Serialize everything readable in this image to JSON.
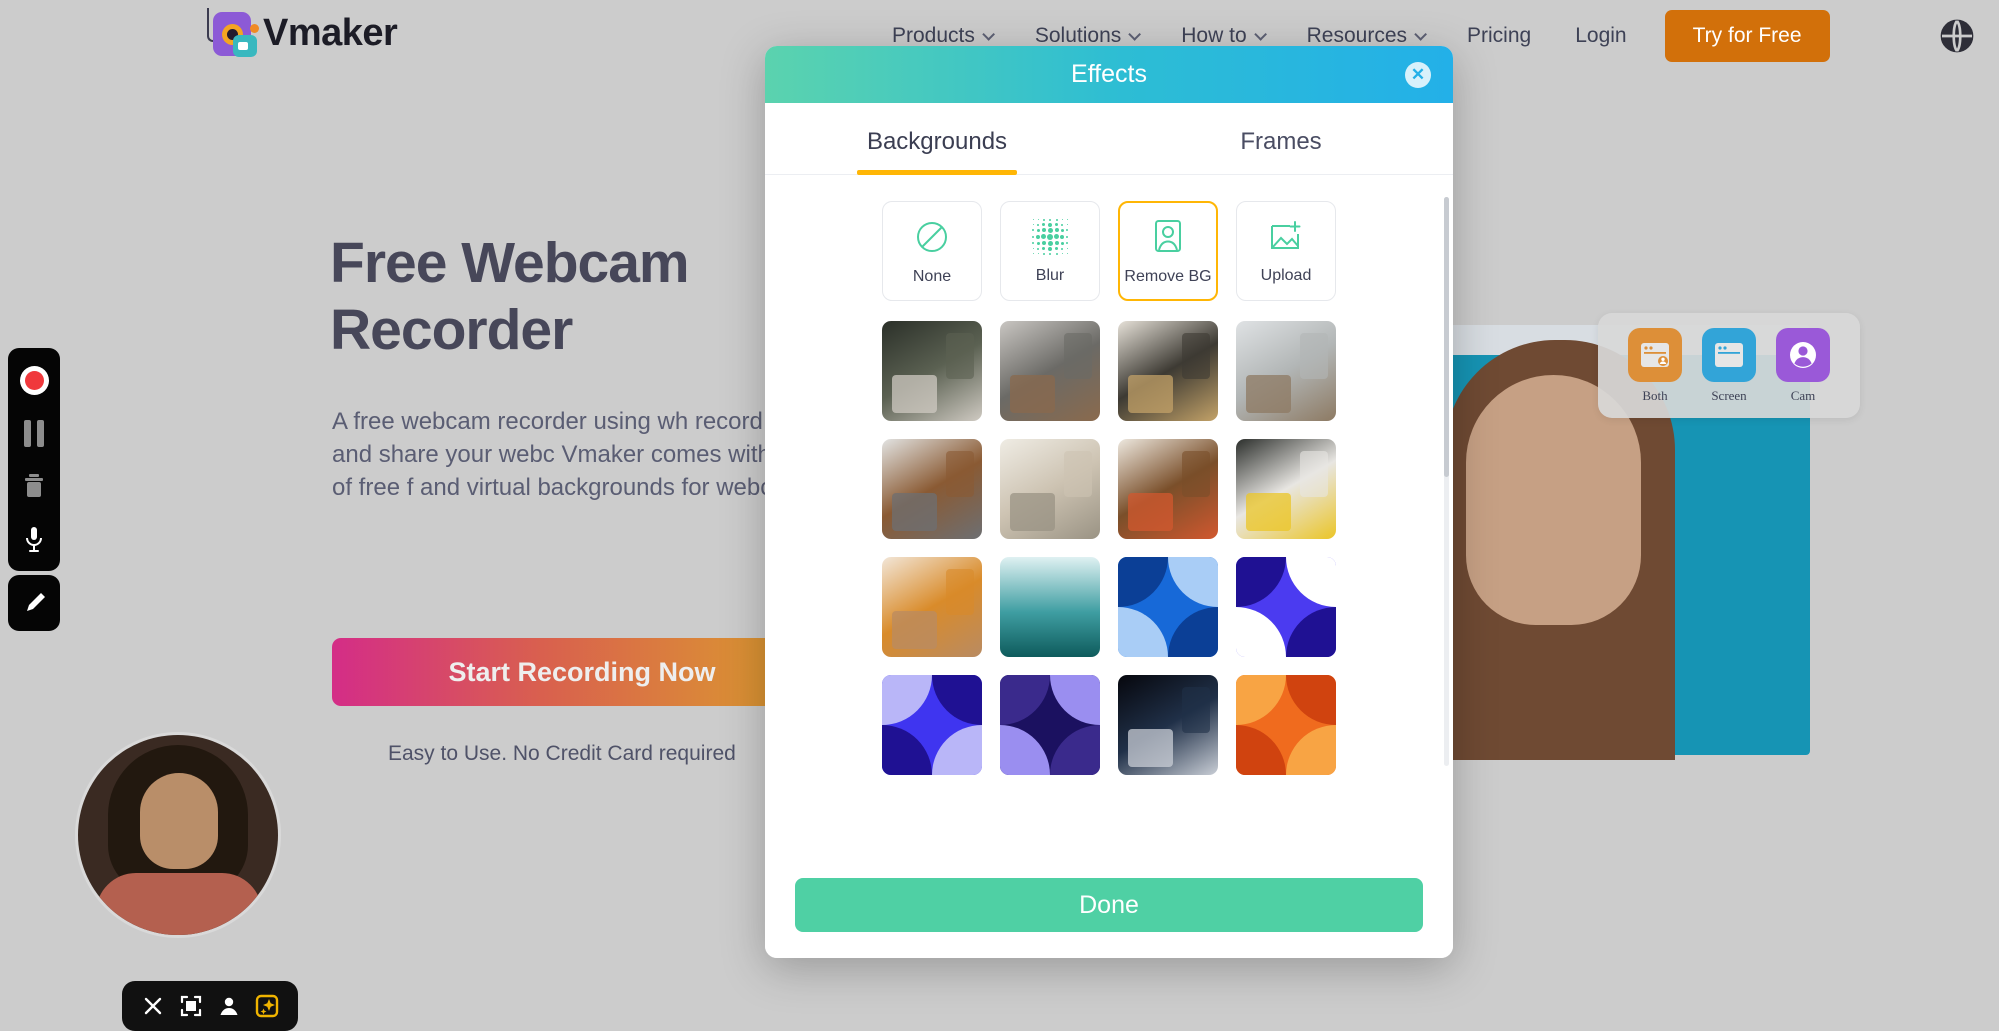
{
  "site": {
    "brand": "Vmaker",
    "nav_items": [
      {
        "label": "Products",
        "has_caret": true
      },
      {
        "label": "Solutions",
        "has_caret": true
      },
      {
        "label": "How to",
        "has_caret": true
      },
      {
        "label": "Resources",
        "has_caret": true
      },
      {
        "label": "Pricing",
        "has_caret": false
      },
      {
        "label": "Login",
        "has_caret": false
      }
    ],
    "cta_label": "Try for Free",
    "cta_color": "#d2700a",
    "globe_icon": "globe-icon",
    "hero_title_line1": "Free Webcam",
    "hero_title_line2": "Recorder",
    "hero_paragraph": "A free webcam recorder using wh record, edit, and share your webc Vmaker comes with a set of free f and virtual backgrounds for webc",
    "hero_button": "Start Recording Now",
    "hero_note": "Easy to Use. No Credit Card required"
  },
  "mode_panel": {
    "items": [
      {
        "label": "Both",
        "icon": "both-window-cam-icon",
        "color": "#dd8f38"
      },
      {
        "label": "Screen",
        "icon": "screen-window-icon",
        "color": "#32a4d8"
      },
      {
        "label": "Cam",
        "icon": "cam-person-icon",
        "color": "#9a59d8"
      }
    ]
  },
  "recorder_toolbar": {
    "buttons": [
      {
        "name": "record-button",
        "icon": "record-dot-icon"
      },
      {
        "name": "pause-button",
        "icon": "pause-icon"
      },
      {
        "name": "delete-button",
        "icon": "trash-icon"
      },
      {
        "name": "mic-button",
        "icon": "microphone-icon"
      }
    ],
    "pen_button": {
      "name": "pen-button",
      "icon": "pen-icon"
    }
  },
  "cam_toolbar": {
    "buttons": [
      {
        "name": "close-cam-button",
        "icon": "close-x-icon"
      },
      {
        "name": "resize-cam-button",
        "icon": "expand-frame-icon"
      },
      {
        "name": "avatar-cam-button",
        "icon": "person-icon"
      },
      {
        "name": "effects-cam-button",
        "icon": "sparkle-effects-icon",
        "active": true
      }
    ]
  },
  "modal": {
    "title": "Effects",
    "close_icon": "close-circle-icon",
    "header_gradient": [
      "#5bd3ae",
      "#23b0e8"
    ],
    "accent_color": "#ffb605",
    "tabs": [
      {
        "label": "Backgrounds",
        "active": true
      },
      {
        "label": "Frames",
        "active": false
      }
    ],
    "options": [
      {
        "label": "None",
        "icon": "no-background-icon",
        "selected": false
      },
      {
        "label": "Blur",
        "icon": "blur-dots-icon",
        "selected": false
      },
      {
        "label": "Remove BG",
        "icon": "remove-background-person-icon",
        "selected": true
      },
      {
        "label": "Upload",
        "icon": "upload-image-icon",
        "selected": false
      }
    ],
    "thumbnails": [
      {
        "name": "dark-green-armchair-room",
        "kind": "photo",
        "palette": [
          "#2b3029",
          "#5b6152",
          "#cfcac2"
        ]
      },
      {
        "name": "modern-staircase-dining",
        "kind": "photo",
        "palette": [
          "#c9c6c2",
          "#6b6a66",
          "#8a6a4d"
        ]
      },
      {
        "name": "bright-living-room-kitchen",
        "kind": "photo",
        "palette": [
          "#e6e1d8",
          "#3d3a33",
          "#c3a268"
        ]
      },
      {
        "name": "white-home-office-desk",
        "kind": "photo",
        "palette": [
          "#dfe2e4",
          "#b2b6b6",
          "#8d7a63"
        ]
      },
      {
        "name": "wood-panel-lounge",
        "kind": "photo",
        "palette": [
          "#e2e3e2",
          "#8a5a33",
          "#6d6f72"
        ]
      },
      {
        "name": "minimal-beige-living-room",
        "kind": "photo",
        "palette": [
          "#efece4",
          "#cdc3b2",
          "#9a9384"
        ]
      },
      {
        "name": "arched-curtain-living-room",
        "kind": "photo",
        "palette": [
          "#ede8df",
          "#7a4f2a",
          "#d1582f"
        ]
      },
      {
        "name": "yellow-armchair-dark-wall",
        "kind": "photo",
        "palette": [
          "#2c2f2c",
          "#e8e6e2",
          "#ebc527"
        ]
      },
      {
        "name": "sunlit-dining-nook",
        "kind": "photo",
        "palette": [
          "#f2e6d8",
          "#d98b2a",
          "#b98b62"
        ]
      },
      {
        "name": "teal-mountain-gradient",
        "kind": "gradient",
        "palette": [
          "#dff1f2",
          "#3f9ea2",
          "#0e5b5c"
        ]
      },
      {
        "name": "blue-geometric-shapes",
        "kind": "pattern",
        "palette": [
          "#1769d8",
          "#0b3f96",
          "#a9cdf6"
        ]
      },
      {
        "name": "indigo-memphis-pattern",
        "kind": "pattern",
        "palette": [
          "#4b3bf0",
          "#1f1193",
          "#ffffff"
        ]
      },
      {
        "name": "blue-triangles-pattern",
        "kind": "pattern",
        "palette": [
          "#3f35f0",
          "#b9b6f8",
          "#1f1193"
        ]
      },
      {
        "name": "dark-purple-abstract",
        "kind": "pattern",
        "palette": [
          "#1b1160",
          "#3a2a8c",
          "#9a8ef0"
        ]
      },
      {
        "name": "dark-blue-blurred-device",
        "kind": "photo",
        "palette": [
          "#06070d",
          "#203048",
          "#c9ced6"
        ]
      },
      {
        "name": "orange-liquid-waves",
        "kind": "pattern",
        "palette": [
          "#f06b1e",
          "#f8a444",
          "#d0430f"
        ]
      }
    ],
    "done_label": "Done",
    "done_color": "#4fd0a4"
  }
}
